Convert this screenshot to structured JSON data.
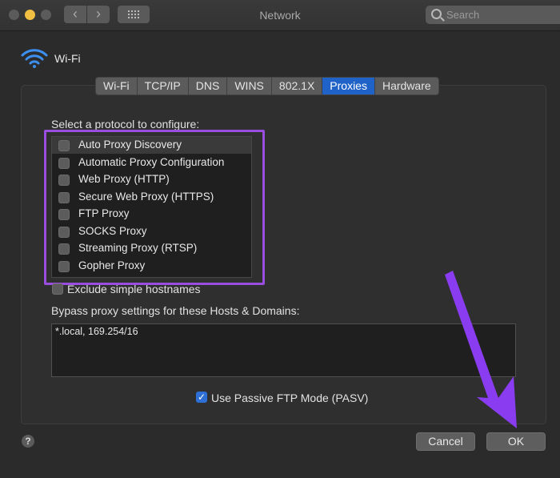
{
  "window": {
    "title": "Network"
  },
  "toolbar": {
    "back_glyph": "‹",
    "forward_glyph": "›",
    "search_placeholder": "Search"
  },
  "interface": {
    "name": "Wi-Fi",
    "icon": "wifi-icon"
  },
  "tabs": [
    {
      "label": "Wi-Fi",
      "active": false
    },
    {
      "label": "TCP/IP",
      "active": false
    },
    {
      "label": "DNS",
      "active": false
    },
    {
      "label": "WINS",
      "active": false
    },
    {
      "label": "802.1X",
      "active": false
    },
    {
      "label": "Proxies",
      "active": true
    },
    {
      "label": "Hardware",
      "active": false
    }
  ],
  "proxies": {
    "select_label": "Select a protocol to configure:",
    "protocols": [
      {
        "label": "Auto Proxy Discovery",
        "checked": false
      },
      {
        "label": "Automatic Proxy Configuration",
        "checked": false
      },
      {
        "label": "Web Proxy (HTTP)",
        "checked": false
      },
      {
        "label": "Secure Web Proxy (HTTPS)",
        "checked": false
      },
      {
        "label": "FTP Proxy",
        "checked": false
      },
      {
        "label": "SOCKS Proxy",
        "checked": false
      },
      {
        "label": "Streaming Proxy (RTSP)",
        "checked": false
      },
      {
        "label": "Gopher Proxy",
        "checked": false
      }
    ],
    "exclude_label": "Exclude simple hostnames",
    "exclude_checked": false,
    "bypass_label": "Bypass proxy settings for these Hosts & Domains:",
    "bypass_value": "*.local, 169.254/16",
    "pasv_label": "Use Passive FTP Mode (PASV)",
    "pasv_checked": true
  },
  "footer": {
    "help": "?",
    "cancel_label": "Cancel",
    "ok_label": "OK"
  },
  "colors": {
    "accent": "#1f63c8",
    "highlight": "#9a4ee0",
    "arrow": "#8a3cf0"
  }
}
